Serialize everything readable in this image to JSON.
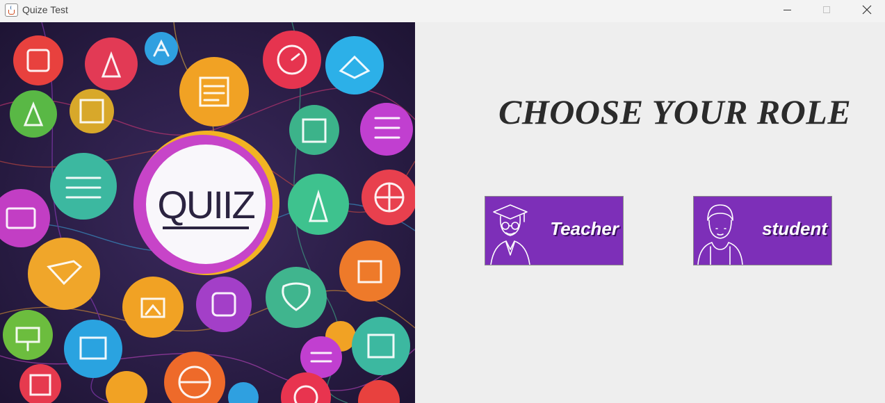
{
  "window": {
    "title": "Quize Test",
    "controls": {
      "minimize": "minimize-icon",
      "maximize": "maximize-icon",
      "close": "close-icon"
    }
  },
  "hero": {
    "badge_text": "QUIIZ",
    "icon": "java-app-icon"
  },
  "role_panel": {
    "heading": "CHOOSE YOUR ROLE",
    "buttons": [
      {
        "label": "Teacher",
        "icon": "teacher-graduate-icon"
      },
      {
        "label": "student",
        "icon": "student-icon"
      }
    ]
  },
  "colors": {
    "button_bg": "#7d2fb8",
    "panel_bg": "#eeeeee",
    "hero_bg": "#2a1c46",
    "heading": "#2b2b2b"
  }
}
